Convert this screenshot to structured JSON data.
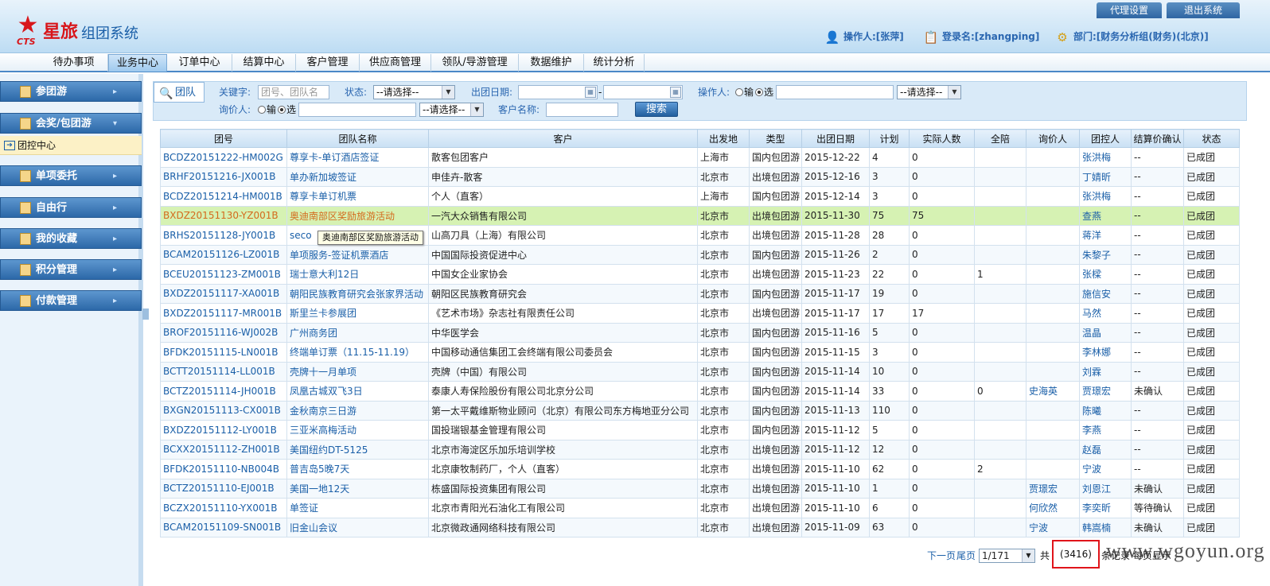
{
  "header": {
    "brand": "星旅",
    "system_name": "组团系统",
    "cts": "CTS",
    "agent_settings": "代理设置",
    "logout": "退出系统",
    "operator": "操作人:[张萍]",
    "login_name": "登录名:[zhangping]",
    "department": "部门:[财务分析组(财务)(北京)]"
  },
  "nav": {
    "tabs": [
      "待办事项",
      "业务中心",
      "订单中心",
      "结算中心",
      "客户管理",
      "供应商管理",
      "领队/导游管理",
      "数据维护",
      "统计分析"
    ],
    "active_index": 1
  },
  "sidebar": {
    "items": [
      "参团游",
      "会奖/包团游",
      "单项委托",
      "自由行",
      "我的收藏",
      "积分管理",
      "付款管理"
    ],
    "sub_item": "团控中心"
  },
  "filter": {
    "tab": "团队",
    "keyword_label": "关键字:",
    "keyword_placeholder": "团号、团队名",
    "status_label": "状态:",
    "status_value": "--请选择--",
    "depart_date_label": "出团日期:",
    "date_sep": "-",
    "operator_label": "操作人:",
    "radio_input": "输",
    "radio_select": "选",
    "operator_select": "--请选择--",
    "inquirer_label": "询价人:",
    "inquirer_select": "--请选择--",
    "customer_label": "客户名称:",
    "search_button": "搜索"
  },
  "table": {
    "headers": [
      "团号",
      "团队名称",
      "客户",
      "出发地",
      "类型",
      "出团日期",
      "计划",
      "实际人数",
      "全陪",
      "询价人",
      "团控人",
      "结算价确认",
      "状态"
    ],
    "rows": [
      [
        "BCDZ20151222-HM002G",
        "尊享卡-单订酒店签证",
        "散客包团客户",
        "上海市",
        "国内包团游",
        "2015-12-22",
        "4",
        "0",
        "",
        "",
        "张洪梅",
        "--",
        "已成团"
      ],
      [
        "BRHF20151216-JX001B",
        "单办新加坡签证",
        "申佳卉-散客",
        "北京市",
        "出境包团游",
        "2015-12-16",
        "3",
        "0",
        "",
        "",
        "丁婧昕",
        "--",
        "已成团"
      ],
      [
        "BCDZ20151214-HM001B",
        "尊享卡单订机票",
        "个人（直客）",
        "上海市",
        "国内包团游",
        "2015-12-14",
        "3",
        "0",
        "",
        "",
        "张洪梅",
        "--",
        "已成团"
      ],
      [
        "BXDZ20151130-YZ001B",
        "奥迪南部区奖励旅游活动",
        "一汽大众销售有限公司",
        "北京市",
        "出境包团游",
        "2015-11-30",
        "75",
        "75",
        "",
        "",
        "查燕",
        "--",
        "已成团"
      ],
      [
        "BRHS20151128-JY001B",
        "seco",
        "山高刀具（上海）有限公司",
        "北京市",
        "出境包团游",
        "2015-11-28",
        "28",
        "0",
        "",
        "",
        "蒋洋",
        "--",
        "已成团"
      ],
      [
        "BCAM20151126-LZ001B",
        "单项服务-签证机票酒店",
        "中国国际投资促进中心",
        "北京市",
        "国内包团游",
        "2015-11-26",
        "2",
        "0",
        "",
        "",
        "朱黎子",
        "--",
        "已成团"
      ],
      [
        "BCEU20151123-ZM001B",
        "瑞士意大利12日",
        "中国女企业家协会",
        "北京市",
        "出境包团游",
        "2015-11-23",
        "22",
        "0",
        "1",
        "",
        "张樑",
        "--",
        "已成团"
      ],
      [
        "BXDZ20151117-XA001B",
        "朝阳民族教育研究会张家界活动",
        "朝阳区民族教育研究会",
        "北京市",
        "国内包团游",
        "2015-11-17",
        "19",
        "0",
        "",
        "",
        "施信安",
        "--",
        "已成团"
      ],
      [
        "BXDZ20151117-MR001B",
        "斯里兰卡参展团",
        "《艺术市场》杂志社有限责任公司",
        "北京市",
        "出境包团游",
        "2015-11-17",
        "17",
        "17",
        "",
        "",
        "马然",
        "--",
        "已成团"
      ],
      [
        "BROF20151116-WJ002B",
        "广州商务团",
        "中华医学会",
        "北京市",
        "国内包团游",
        "2015-11-16",
        "5",
        "0",
        "",
        "",
        "温晶",
        "--",
        "已成团"
      ],
      [
        "BFDK20151115-LN001B",
        "终端单订票（11.15-11.19）",
        "中国移动通信集团工会终端有限公司委员会",
        "北京市",
        "国内包团游",
        "2015-11-15",
        "3",
        "0",
        "",
        "",
        "李林娜",
        "--",
        "已成团"
      ],
      [
        "BCTT20151114-LL001B",
        "壳牌十一月单项",
        "壳牌（中国）有限公司",
        "北京市",
        "国内包团游",
        "2015-11-14",
        "10",
        "0",
        "",
        "",
        "刘霖",
        "--",
        "已成团"
      ],
      [
        "BCTZ20151114-JH001B",
        "凤凰古城双飞3日",
        "泰康人寿保险股份有限公司北京分公司",
        "北京市",
        "国内包团游",
        "2015-11-14",
        "33",
        "0",
        "0",
        "史海英",
        "贾璟宏",
        "未确认",
        "已成团"
      ],
      [
        "BXGN20151113-CX001B",
        "金秋南京三日游",
        "第一太平戴维斯物业顾问（北京）有限公司东方梅地亚分公司",
        "北京市",
        "国内包团游",
        "2015-11-13",
        "110",
        "0",
        "",
        "",
        "陈曦",
        "--",
        "已成团"
      ],
      [
        "BXDZ20151112-LY001B",
        "三亚米高梅活动",
        "国投瑞银基金管理有限公司",
        "北京市",
        "国内包团游",
        "2015-11-12",
        "5",
        "0",
        "",
        "",
        "李燕",
        "--",
        "已成团"
      ],
      [
        "BCXX20151112-ZH001B",
        "美国纽约DT-5125",
        "北京市海淀区乐加乐培训学校",
        "北京市",
        "出境包团游",
        "2015-11-12",
        "12",
        "0",
        "",
        "",
        "赵磊",
        "--",
        "已成团"
      ],
      [
        "BFDK20151110-NB004B",
        "普吉岛5晚7天",
        "北京康牧制药厂，个人（直客）",
        "北京市",
        "出境包团游",
        "2015-11-10",
        "62",
        "0",
        "2",
        "",
        "宁波",
        "--",
        "已成团"
      ],
      [
        "BCTZ20151110-EJ001B",
        "美国一地12天",
        "栋盛国际投资集团有限公司",
        "北京市",
        "出境包团游",
        "2015-11-10",
        "1",
        "0",
        "",
        "贾璟宏",
        "刘恩江",
        "未确认",
        "已成团"
      ],
      [
        "BCZX20151110-YX001B",
        "单签证",
        "北京市青阳光石油化工有限公司",
        "北京市",
        "出境包团游",
        "2015-11-10",
        "6",
        "0",
        "",
        "何欣然",
        "李奕昕",
        "等待确认",
        "已成团"
      ],
      [
        "BCAM20151109-SN001B",
        "旧金山会议",
        "北京微政通网络科技有限公司",
        "北京市",
        "出境包团游",
        "2015-11-09",
        "63",
        "0",
        "",
        "宁波",
        "韩嵩楠",
        "未确认",
        "已成团"
      ]
    ],
    "highlight_row": 3
  },
  "tooltip": "奥迪南部区奖励旅游活动",
  "pager": {
    "next": "下一页",
    "last": "尾页",
    "page_value": "1/171",
    "total_prefix": "共",
    "total_count": "(3416)",
    "rest": "条记录 每页显示",
    "watermark": "www.wgoyun.org"
  }
}
